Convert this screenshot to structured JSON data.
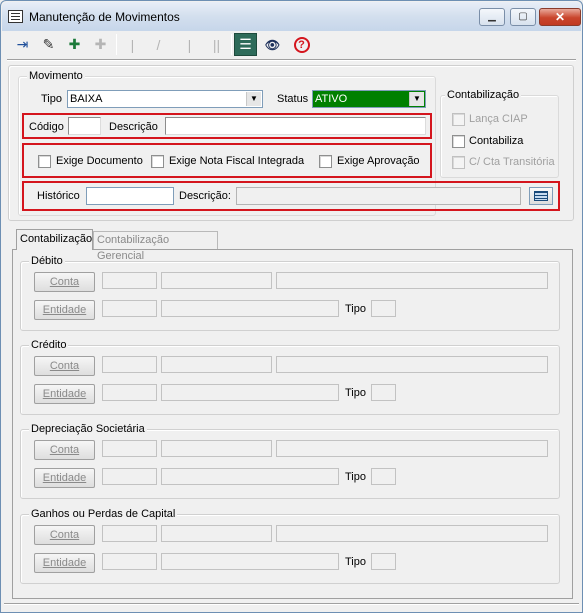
{
  "window": {
    "title": "Manutenção de Movimentos",
    "controls": {
      "minimize": "▁",
      "maximize": "▢",
      "close": "✕"
    }
  },
  "toolbar": {
    "buttons": [
      {
        "name": "exit",
        "icon": "exit-door-icon",
        "glyph": "⇥",
        "enabled": true
      },
      {
        "name": "clear",
        "icon": "eraser-icon",
        "glyph": "✎",
        "enabled": true
      },
      {
        "name": "new",
        "icon": "add-record-icon",
        "glyph": "✚",
        "enabled": true
      },
      {
        "name": "remove",
        "icon": "remove-record-icon",
        "glyph": "✚",
        "enabled": false
      },
      {
        "name": "first",
        "icon": "first-record-icon",
        "glyph": "|",
        "enabled": false
      },
      {
        "name": "prev",
        "icon": "previous-record-icon",
        "glyph": "/",
        "enabled": false
      },
      {
        "name": "next",
        "icon": "next-record-icon",
        "glyph": "|",
        "enabled": false
      },
      {
        "name": "last",
        "icon": "last-record-icon",
        "glyph": "||",
        "enabled": false
      },
      {
        "name": "list",
        "icon": "list-icon",
        "glyph": "☰",
        "enabled": true
      },
      {
        "name": "search",
        "icon": "binoculars-icon",
        "glyph": "👁",
        "enabled": true
      },
      {
        "name": "help",
        "icon": "help-icon",
        "glyph": "?",
        "enabled": true
      }
    ]
  },
  "movimento": {
    "legend": "Movimento",
    "tipo_label": "Tipo",
    "tipo_value": "BAIXA",
    "status_label": "Status",
    "status_value": "ATIVO",
    "codigo_label": "Código",
    "codigo_value": "",
    "descricao_label": "Descrição",
    "descricao_value": "",
    "checks": [
      {
        "label": "Exige Documento",
        "checked": false
      },
      {
        "label": "Exige Nota Fiscal Integrada",
        "checked": false
      },
      {
        "label": "Exige Aprovação",
        "checked": false
      }
    ],
    "historico_label": "Histórico",
    "historico_value": "",
    "hist_descricao_label": "Descrição:",
    "hist_descricao_value": ""
  },
  "contabilizacao_box": {
    "legend": "Contabilização",
    "items": [
      {
        "label": "Lança CIAP",
        "checked": false,
        "enabled": false
      },
      {
        "label": "Contabiliza",
        "checked": false,
        "enabled": true
      },
      {
        "label": "C/ Cta Transitória",
        "checked": false,
        "enabled": false
      }
    ]
  },
  "tabs": [
    {
      "label": "Contabilização",
      "active": true
    },
    {
      "label": "Contabilização Gerencial",
      "active": false
    }
  ],
  "sections": [
    {
      "legend": "Débito",
      "conta_label": "Conta",
      "entidade_label": "Entidade",
      "tipo_label": "Tipo"
    },
    {
      "legend": "Crédito",
      "conta_label": "Conta",
      "entidade_label": "Entidade",
      "tipo_label": "Tipo"
    },
    {
      "legend": "Depreciação Societária",
      "conta_label": "Conta",
      "entidade_label": "Entidade",
      "tipo_label": "Tipo"
    },
    {
      "legend": "Ganhos ou Perdas de Capital",
      "conta_label": "Conta",
      "entidade_label": "Entidade",
      "tipo_label": "Tipo"
    }
  ],
  "colors": {
    "status_bg": "#008000",
    "highlight": "#d4151d"
  }
}
